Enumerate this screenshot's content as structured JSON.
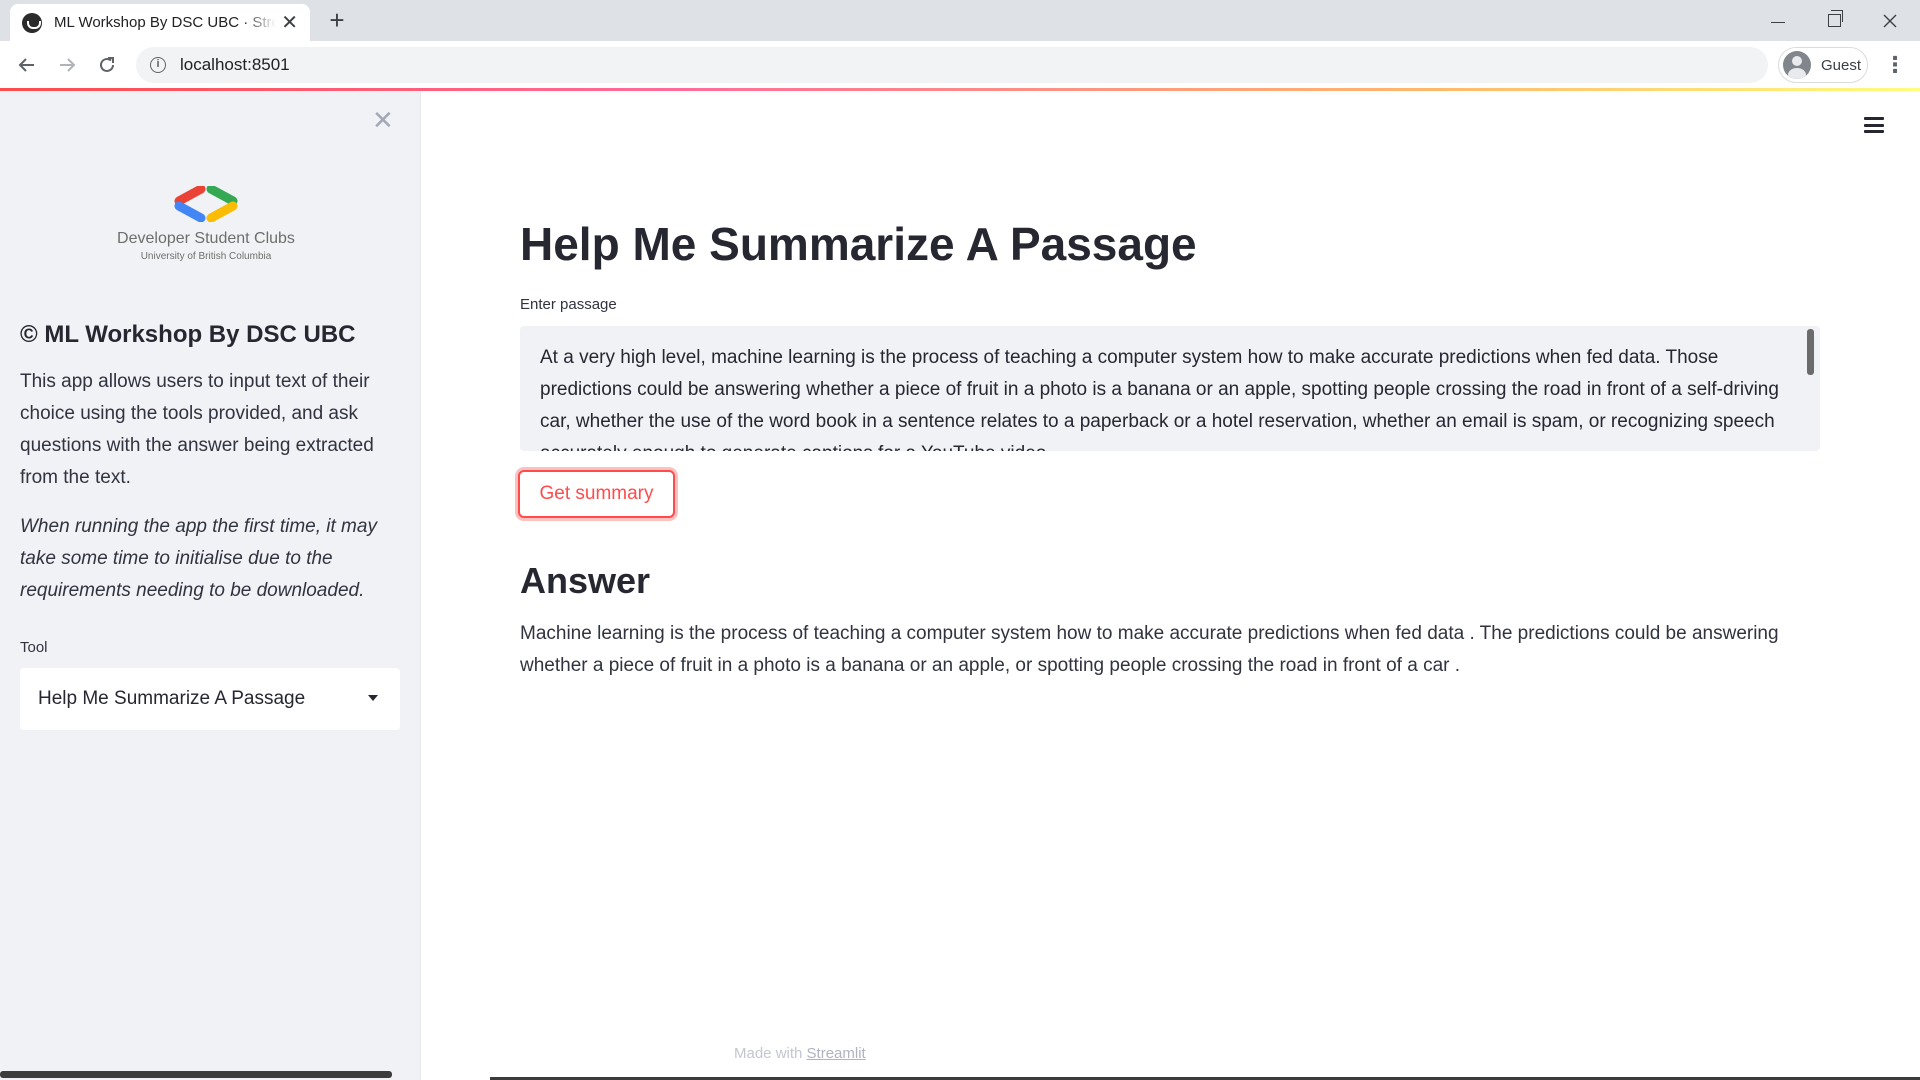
{
  "browser": {
    "tab_title": "ML Workshop By DSC UBC · Streamlit",
    "url": "localhost:8501",
    "profile_label": "Guest",
    "new_tab_symbol": "+",
    "close_symbol": "✕"
  },
  "sidebar": {
    "close_symbol": "✕",
    "logo_title": "Developer Student Clubs",
    "logo_subtitle": "University of British Columbia",
    "heading": "© ML Workshop By DSC UBC",
    "description": "This app allows users to input text of their choice using the tools provided, and ask questions with the answer being extracted from the text.",
    "note": "When running the app the first time, it may take some time to initialise due to the requirements needing to be downloaded.",
    "tool_label": "Tool",
    "tool_selected": "Help Me Summarize A Passage"
  },
  "main": {
    "title": "Help Me Summarize A Passage",
    "input_label": "Enter passage",
    "passage": "At a very high level, machine learning is the process of teaching a computer system how to make accurate predictions when fed data. Those predictions could be answering whether a piece of fruit in a photo is a banana or an apple, spotting people crossing the road in front of a self-driving car, whether the use of the word book in a sentence relates to a paperback or a hotel reservation, whether an email is spam, or recognizing speech accurately enough to generate captions for a YouTube video.",
    "button_label": "Get summary",
    "answer_heading": "Answer",
    "answer_text": "Machine learning is the process of teaching a computer system how to make accurate predictions when fed data . The predictions could be answering whether a piece of fruit in a photo is a banana or an apple, or spotting people crossing the road in front of a car ."
  },
  "footer": {
    "prefix": "Made with",
    "link": "Streamlit"
  },
  "colors": {
    "accent": "#ff4b4b",
    "sidebar_bg": "#f0f2f6",
    "text": "#262730"
  },
  "icons": {
    "back": "arrow-left-icon",
    "forward": "arrow-right-icon",
    "reload": "reload-icon",
    "info": "info-icon",
    "menu": "hamburger-icon"
  }
}
